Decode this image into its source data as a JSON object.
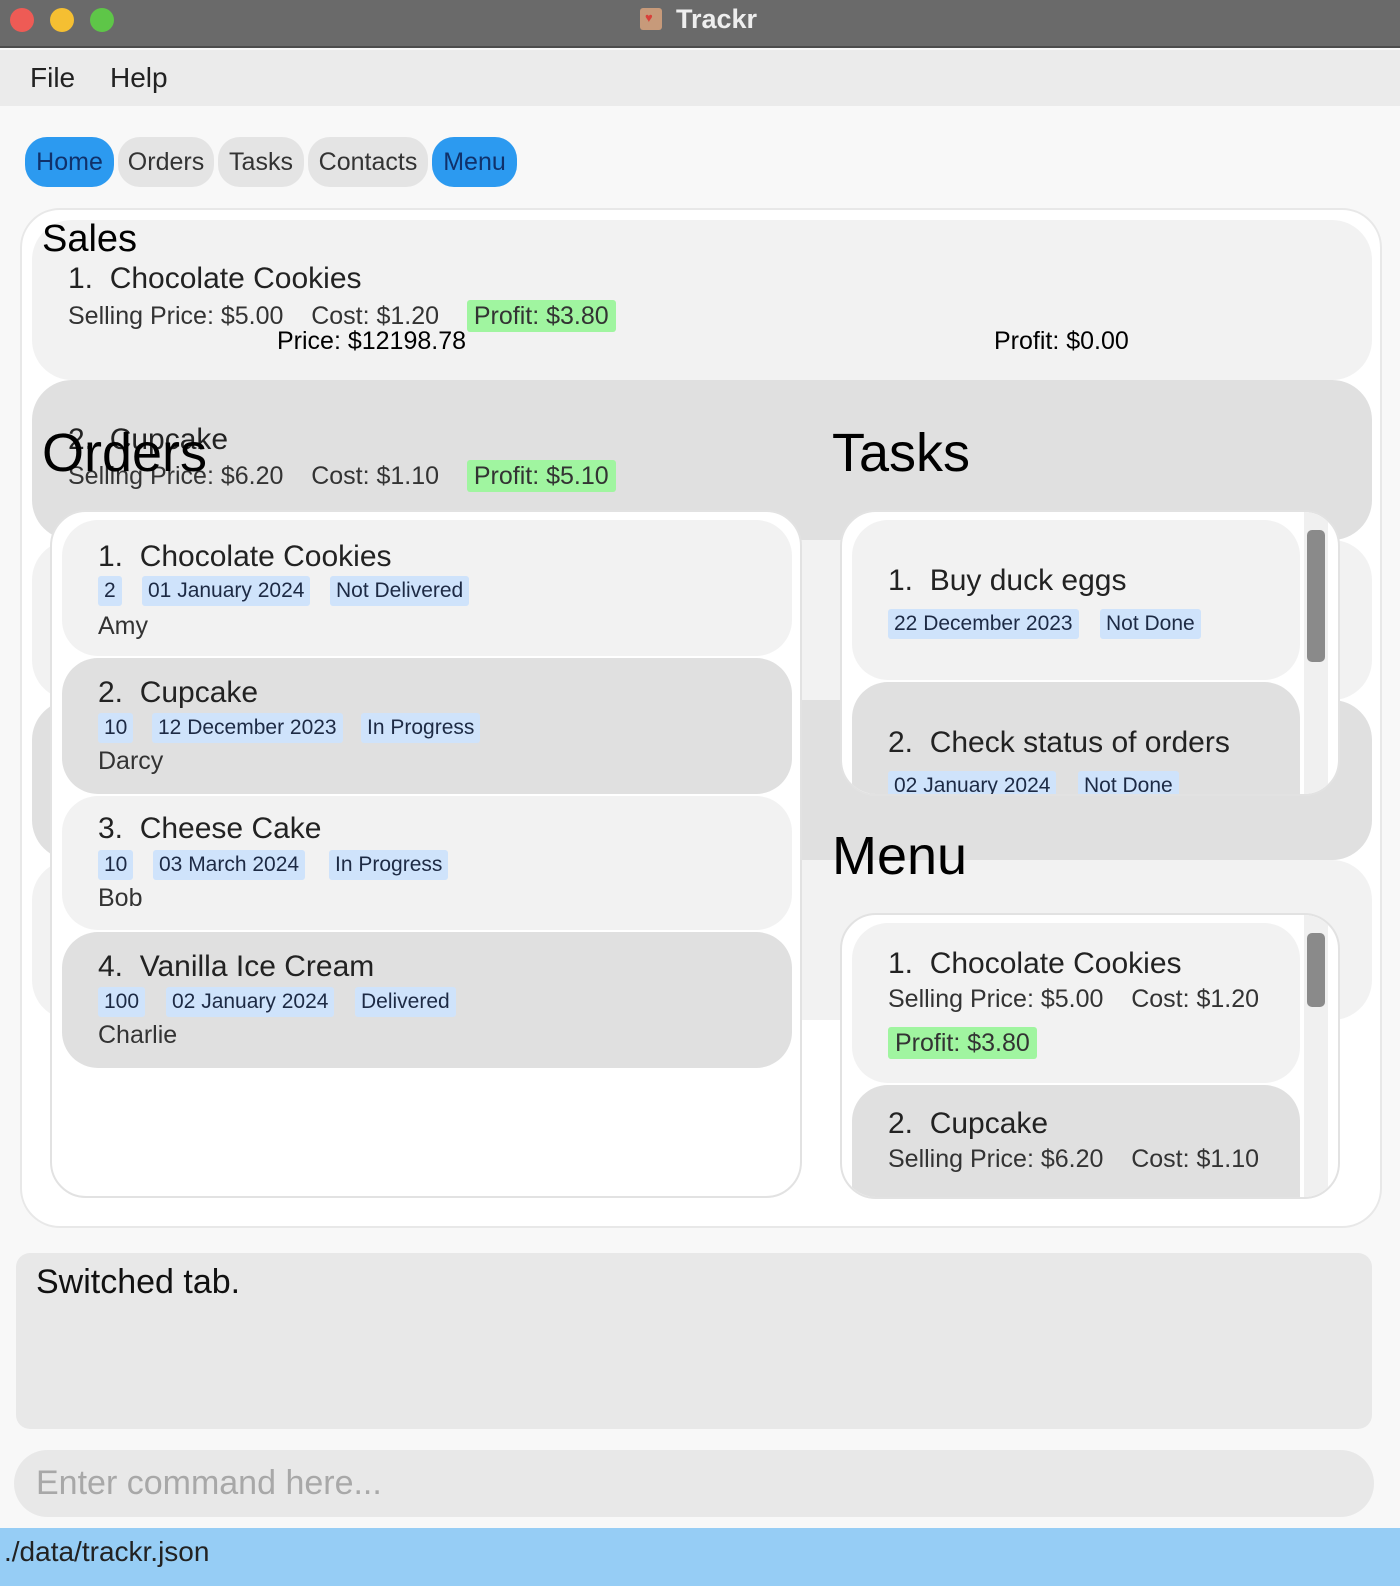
{
  "window": {
    "title": "Trackr"
  },
  "menubar": {
    "file": "File",
    "help": "Help"
  },
  "tabs": [
    "Home",
    "Orders",
    "Tasks",
    "Contacts",
    "Menu"
  ],
  "sales": {
    "title": "Sales",
    "items": [
      {
        "index": "1.",
        "name": "Chocolate Cookies",
        "selling_price": "Selling Price: $5.00",
        "cost": "Cost: $1.20",
        "profit": "Profit: $3.80"
      },
      {
        "index": "2.",
        "name": "Cupcake",
        "selling_price": "Selling Price: $6.20",
        "cost": "Cost: $1.10",
        "profit": "Profit: $5.10"
      }
    ],
    "total_price": "Price: $12198.78",
    "total_profit": "Profit: $0.00"
  },
  "orders": {
    "title": "Orders",
    "items": [
      {
        "index": "1.",
        "name": "Chocolate Cookies",
        "quantity": "2",
        "date": "01 January 2024",
        "status": "Not Delivered",
        "customer": "Amy"
      },
      {
        "index": "2.",
        "name": "Cupcake",
        "quantity": "10",
        "date": "12 December 2023",
        "status": "In Progress",
        "customer": "Darcy"
      },
      {
        "index": "3.",
        "name": "Cheese Cake",
        "quantity": "10",
        "date": "03 March 2024",
        "status": "In Progress",
        "customer": "Bob"
      },
      {
        "index": "4.",
        "name": "Vanilla Ice Cream",
        "quantity": "100",
        "date": "02 January 2024",
        "status": "Delivered",
        "customer": "Charlie"
      }
    ]
  },
  "tasks": {
    "title": "Tasks",
    "items": [
      {
        "index": "1.",
        "name": "Buy duck eggs",
        "date": "22 December 2023",
        "status": "Not Done"
      },
      {
        "index": "2.",
        "name": "Check status of orders",
        "date": "02 January 2024",
        "status": "Not Done"
      }
    ]
  },
  "menu": {
    "title": "Menu",
    "items": [
      {
        "index": "1.",
        "name": "Chocolate Cookies",
        "selling_price": "Selling Price: $5.00",
        "cost": "Cost: $1.20",
        "profit": "Profit: $3.80"
      },
      {
        "index": "2.",
        "name": "Cupcake",
        "selling_price": "Selling Price: $6.20",
        "cost": "Cost: $1.10"
      }
    ]
  },
  "result": {
    "message": "Switched tab."
  },
  "command": {
    "placeholder": "Enter command here..."
  },
  "status": {
    "path": "./data/trackr.json"
  },
  "colors": {
    "active_tab": "#2c9af0",
    "profit_bg": "#a0f5a0",
    "chip_bg": "#cfe3fb",
    "status_bar": "#96cdf5"
  }
}
